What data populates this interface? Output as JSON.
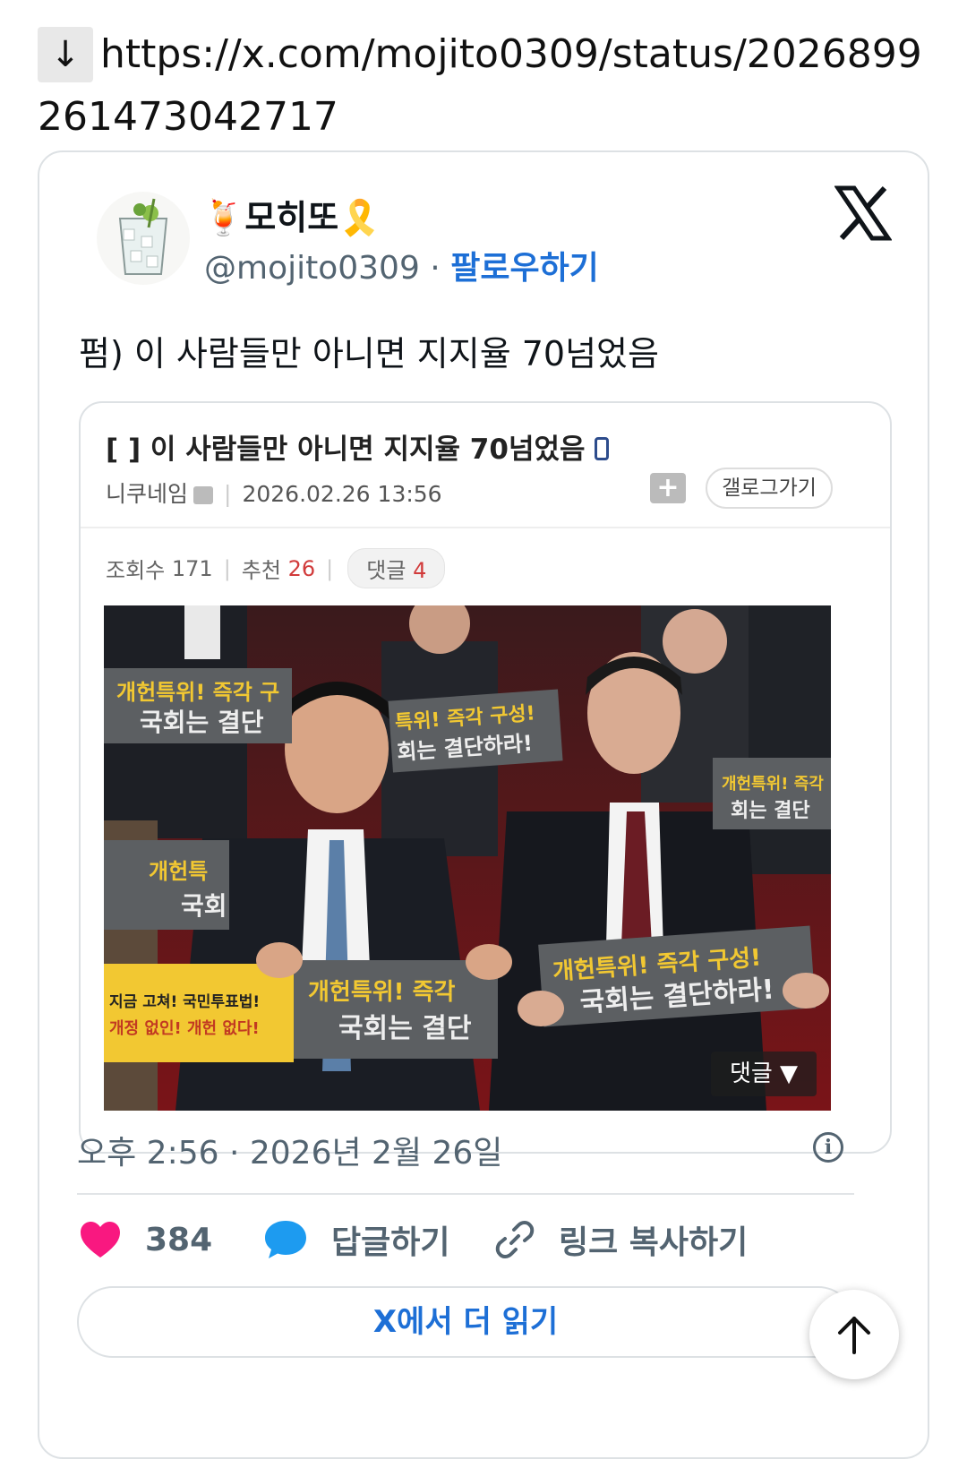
{
  "page": {
    "arrow_symbol": "↓",
    "url": "https://x.com/mojito0309/status/2026899261473042717"
  },
  "tweet": {
    "display_name": "🍹모히또🎗️",
    "handle": "@mojito0309",
    "separator": " · ",
    "follow_label": "팔로우하기",
    "text": "펌) 이 사람들만 아니면 지지율 70넘었음",
    "timestamp": "오후 2:56 · 2026년 2월 26일",
    "likes": "384",
    "reply_label": "답글하기",
    "copy_link_label": "링크 복사하기",
    "read_more_label": "X에서 더 읽기",
    "info_symbol": "i"
  },
  "embed": {
    "title": "[  ] 이 사람들만 아니면 지지율 70넘었음",
    "author": "니쿠네임",
    "date": "2026.02.26 13:56",
    "folder_symbol": "+",
    "blog_button": "갤로그가기",
    "views_label": "조회수",
    "views": "171",
    "recommend_label": "추천",
    "recommend": "26",
    "comments_label": "댓글",
    "comments": "4",
    "photo_comment_badge": "댓글 ▼",
    "photo_banner_texts": [
      "개헌특위! 즉각 구성!",
      "국회는 결단하라!",
      "지금 고쳐! 국민투표법!",
      "개정 없인! 개헌 없다!"
    ]
  },
  "colors": {
    "accent_blue": "#1d6fd6",
    "heart": "#f91880",
    "reply_bubble": "#1d9bf0",
    "muted_text": "#536471"
  }
}
